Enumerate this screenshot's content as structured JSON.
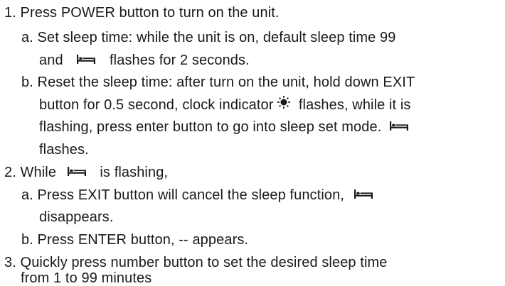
{
  "doc": {
    "s1_line": "1. Press POWER button to turn on the unit.",
    "s1a_line1": "a. Set sleep time:   while the unit is on, default sleep time 99",
    "s1a_line2_pre": "and",
    "s1a_line2_post": "flashes for 2 seconds.",
    "s1b_line1": "b. Reset the sleep time: after turn on the unit, hold down EXIT",
    "s1b_line2_pre": "button for 0.5 second, clock indicator",
    "s1b_line2_post": "flashes, while it is",
    "s1b_line3": "flashing, press enter button to go into sleep set mode.",
    "s1b_line4": "flashes.",
    "s2_line_pre": "2. While",
    "s2_line_post": "is flashing,",
    "s2a_line1": "a. Press EXIT button will cancel the sleep function,",
    "s2a_line2": "disappears.",
    "s2b_line": "b. Press ENTER button, -- appears.",
    "s3_line1": "3. Quickly press number button to set the desired sleep time",
    "s3_line2": "from 1 to 99 minutes"
  },
  "icons": {
    "bed": "bed-icon",
    "clock": "clock-indicator-icon"
  }
}
